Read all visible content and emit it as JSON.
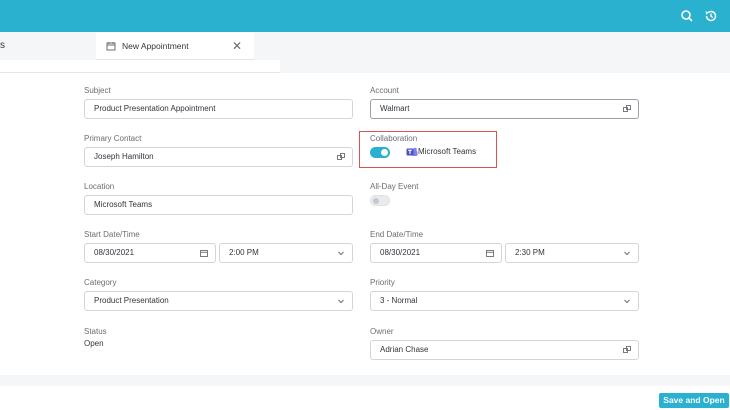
{
  "header": {
    "search_icon": "search-icon",
    "history_icon": "history-icon",
    "accent": "#29b1cf"
  },
  "tabs": {
    "previous_partial": "s",
    "active": "New Appointment"
  },
  "form": {
    "subject": {
      "label": "Subject",
      "value": "Product Presentation Appointment"
    },
    "account": {
      "label": "Account",
      "value": "Walmart"
    },
    "primary_contact": {
      "label": "Primary Contact",
      "value": "Joseph Hamilton"
    },
    "collaboration": {
      "label": "Collaboration",
      "toggle_on": true,
      "service": "Microsoft Teams"
    },
    "location": {
      "label": "Location",
      "value": "Microsoft Teams"
    },
    "all_day": {
      "label": "All-Day Event",
      "toggle_on": false
    },
    "start": {
      "label": "Start Date/Time",
      "date": "08/30/2021",
      "time": "2:00 PM"
    },
    "end": {
      "label": "End Date/Time",
      "date": "08/30/2021",
      "time": "2:30 PM"
    },
    "category": {
      "label": "Category",
      "value": "Product Presentation"
    },
    "priority": {
      "label": "Priority",
      "value": "3 - Normal"
    },
    "status": {
      "label": "Status",
      "value": "Open"
    },
    "owner": {
      "label": "Owner",
      "value": "Adrian Chase"
    }
  },
  "footer": {
    "save_open_label": "Save and Open"
  }
}
